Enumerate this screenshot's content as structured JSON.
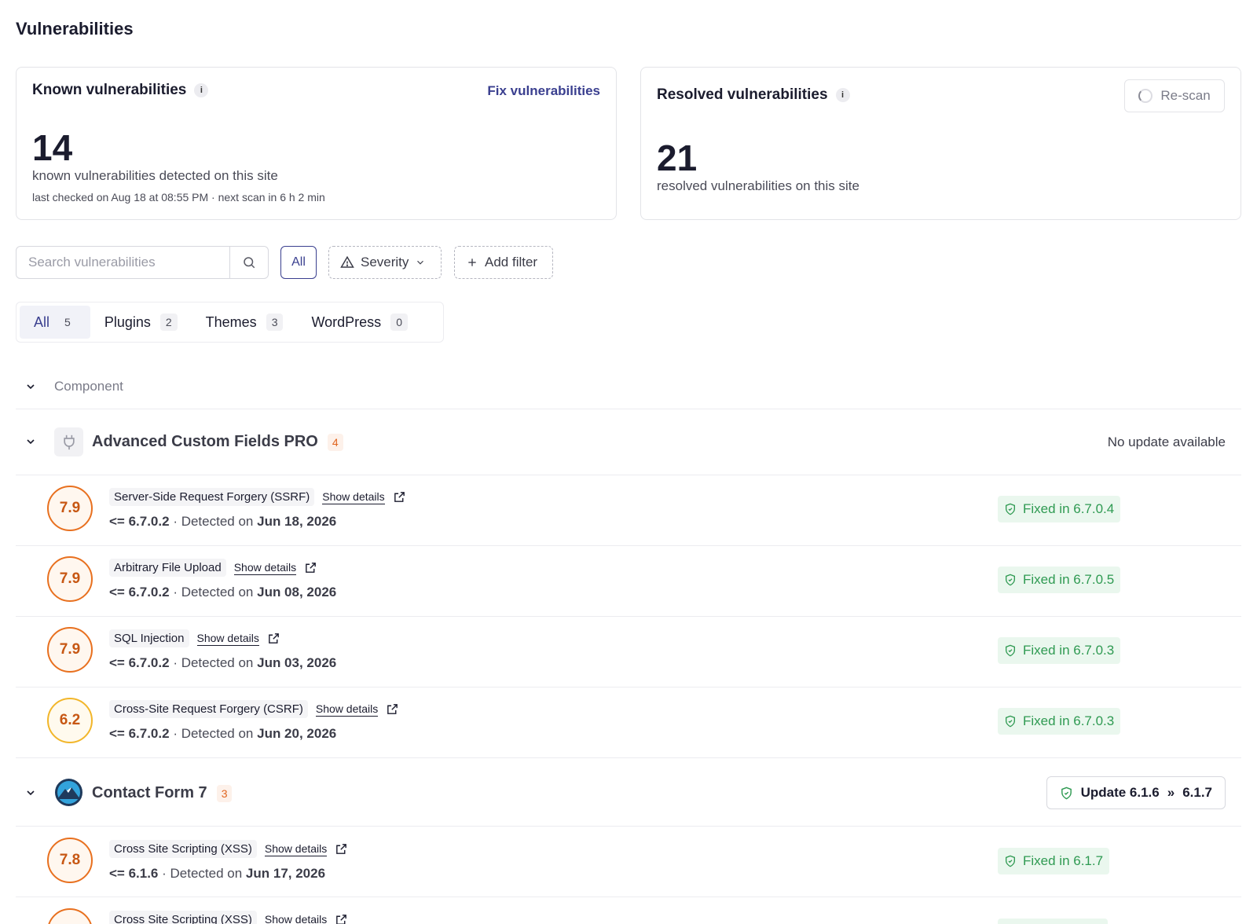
{
  "page_title": "Vulnerabilities",
  "known_card": {
    "title": "Known vulnerabilities",
    "info": "i",
    "link": "Fix vulnerabilities",
    "count": "14",
    "description": "known vulnerabilities detected on this site",
    "sub": "last checked on Aug 18 at 08:55 PM · next scan in 6 h 2 min"
  },
  "resolved_card": {
    "title": "Resolved vulnerabilities",
    "info": "i",
    "rescan_label": "Re-scan",
    "count": "21",
    "description": "resolved vulnerabilities on this site"
  },
  "filters": {
    "search_placeholder": "Search vulnerabilities",
    "all_label": "All",
    "severity_label": "Severity",
    "add_filter_label": "Add filter"
  },
  "tabs": [
    {
      "label": "All",
      "count": "5"
    },
    {
      "label": "Plugins",
      "count": "2"
    },
    {
      "label": "Themes",
      "count": "3"
    },
    {
      "label": "WordPress",
      "count": "0"
    }
  ],
  "table": {
    "component_header": "Component"
  },
  "groups": [
    {
      "name": "Advanced Custom Fields PRO",
      "count": "4",
      "status": "No update available",
      "vulns": [
        {
          "score": "7.9",
          "name": "Server-Side Request Forgery (SSRF)",
          "details": "Show details",
          "version": "<= 6.7.0.2",
          "detected_label": "· Detected on",
          "date": "Jun 18, 2026",
          "fixed": "Fixed in 6.7.0.4"
        },
        {
          "score": "7.9",
          "name": "Arbitrary File Upload",
          "details": "Show details",
          "version": "<= 6.7.0.2",
          "detected_label": "· Detected on",
          "date": "Jun 08, 2026",
          "fixed": "Fixed in 6.7.0.5"
        },
        {
          "score": "7.9",
          "name": "SQL Injection",
          "details": "Show details",
          "version": "<= 6.7.0.2",
          "detected_label": "· Detected on",
          "date": "Jun 03, 2026",
          "fixed": "Fixed in 6.7.0.3"
        },
        {
          "score": "6.2",
          "name": "Cross-Site Request Forgery (CSRF)",
          "details": "Show details",
          "version": "<= 6.7.0.2",
          "detected_label": "· Detected on",
          "date": "Jun 20, 2026",
          "fixed": "Fixed in 6.7.0.3"
        }
      ]
    },
    {
      "name": "Contact Form 7",
      "count": "3",
      "update": {
        "label": "Update 6.1.6",
        "arrow": "»",
        "target": "6.1.7"
      },
      "vulns": [
        {
          "score": "7.8",
          "name": "Cross Site Scripting (XSS)",
          "details": "Show details",
          "version": "<= 6.1.6",
          "detected_label": "· Detected on",
          "date": "Jun 17, 2026",
          "fixed": "Fixed in 6.1.7"
        },
        {
          "name": "Cross Site Scripting (XSS)",
          "details": "Show details"
        }
      ]
    }
  ],
  "colors": {
    "accent": "#3a3f8f",
    "score_high": "#e8701f",
    "score_medium": "#f2b62a",
    "fixed_green": "#2f9a52"
  }
}
